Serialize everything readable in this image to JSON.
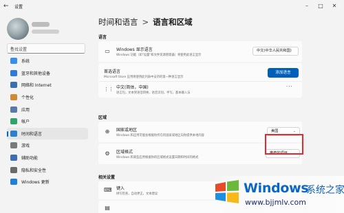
{
  "app": {
    "title": "设置"
  },
  "search": {
    "placeholder": "查找设置"
  },
  "sidebar": {
    "items": [
      {
        "label": "系统",
        "icon": "monitor-icon",
        "color": "#3b8ee8"
      },
      {
        "label": "蓝牙和其他设备",
        "icon": "bluetooth-icon",
        "color": "#2d7bd6"
      },
      {
        "label": "网络和 Internet",
        "icon": "wifi-icon",
        "color": "#3a6fb0"
      },
      {
        "label": "个性化",
        "icon": "brush-icon",
        "color": "#d08a36"
      },
      {
        "label": "应用",
        "icon": "apps-icon",
        "color": "#5a78a8"
      },
      {
        "label": "帐户",
        "icon": "person-icon",
        "color": "#2fa36b"
      },
      {
        "label": "时间和语言",
        "icon": "globe-clock-icon",
        "color": "#2f7fd0",
        "active": true
      },
      {
        "label": "游戏",
        "icon": "gamepad-icon",
        "color": "#7a7a7a"
      },
      {
        "label": "辅助功能",
        "icon": "accessibility-icon",
        "color": "#3e6db5"
      },
      {
        "label": "隐私和安全性",
        "icon": "shield-icon",
        "color": "#6a6a6a"
      },
      {
        "label": "Windows 更新",
        "icon": "update-icon",
        "color": "#1f7fd8"
      }
    ]
  },
  "main": {
    "breadcrumb_parent": "时间和语言",
    "breadcrumb_sep": ">",
    "breadcrumb_current": "语言和区域",
    "section_language": "语言",
    "display_language": {
      "title": "Windows 显示语言",
      "desc": "Windows 功能（如\"设置\"和文件资源管理器）将使用此语言显示",
      "value": "中文(中华人民共和国)"
    },
    "preferred": {
      "title": "首选语言",
      "desc": "Microsoft Store 应用将使用此列表中支持的第一种语言显示",
      "button": "添加语言"
    },
    "chinese": {
      "title": "中文(简体，中国)",
      "desc": "语言包，文本到语音转换，语音识别，手写，基本输入法"
    },
    "section_region": "区域",
    "country": {
      "title": "国家或地区",
      "desc": "Windows 和应用可能会根据你所在的国家或地区向你提供本地内容",
      "value": "美国"
    },
    "region_format": {
      "title": "区域格式",
      "desc": "Windows 和某些应用根据你的区域格式设置日期和时间的格式",
      "value": "推荐的项目"
    },
    "section_related": "相关设置",
    "typing": {
      "title": "键入",
      "desc": "拼写检查，自动更正，文本建议"
    }
  },
  "watermark": {
    "title": "Windows",
    "cn": "系统之家",
    "url": "www.bjjmlv.com"
  }
}
